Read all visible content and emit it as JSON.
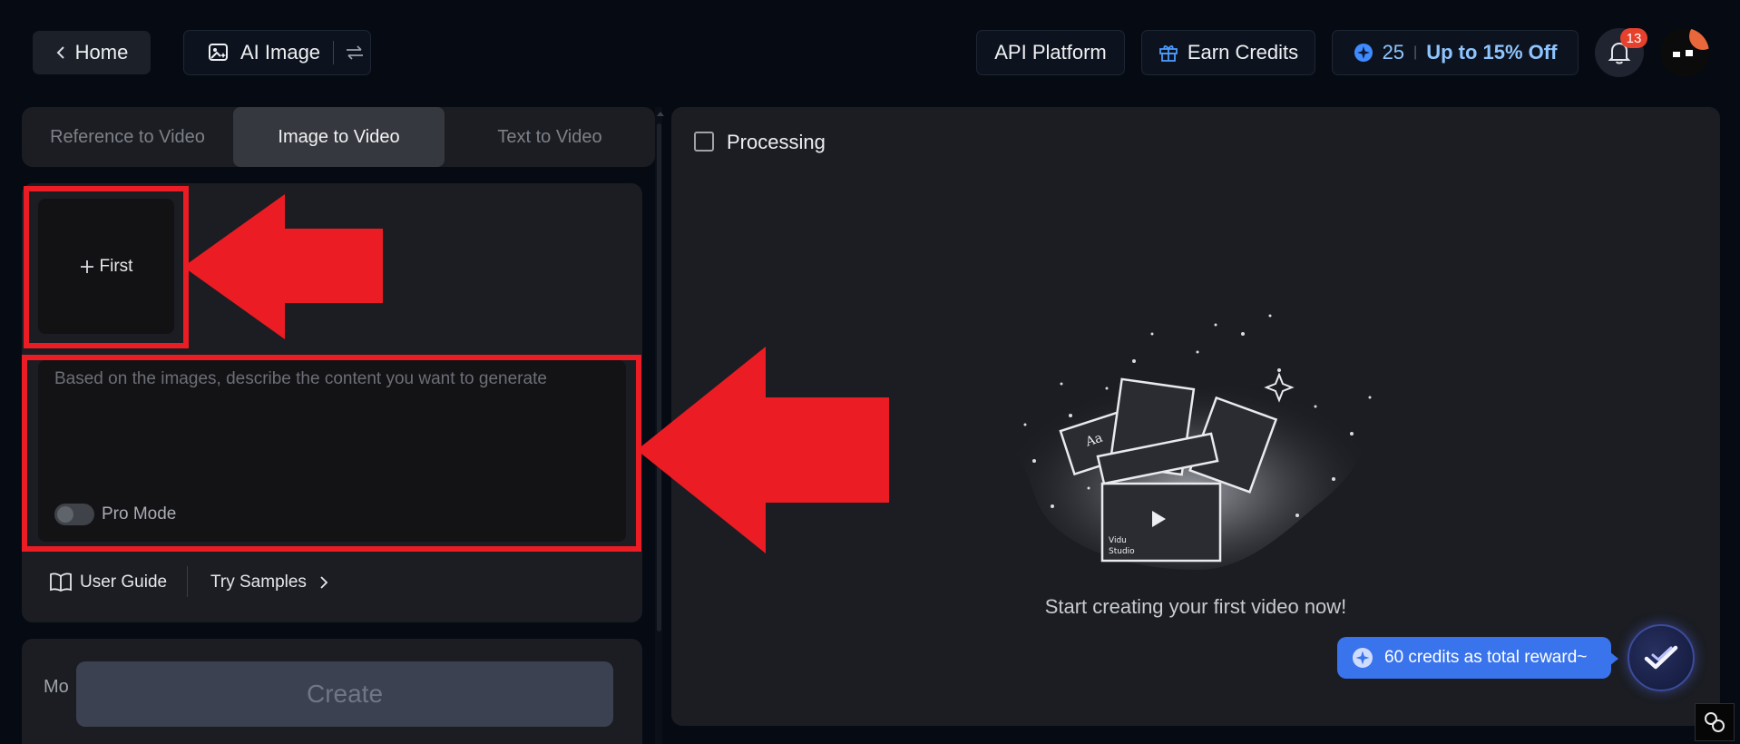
{
  "header": {
    "home_label": "Home",
    "ai_image_label": "AI Image",
    "api_platform_label": "API Platform",
    "earn_credits_label": "Earn Credits",
    "credits_count": "25",
    "credits_separator": "|",
    "discount_label": "Up to 15% Off",
    "notification_count": "13"
  },
  "tabs": [
    {
      "label": "Reference to Video",
      "active": false
    },
    {
      "label": "Image to Video",
      "active": true
    },
    {
      "label": "Text to Video",
      "active": false
    }
  ],
  "upload": {
    "label": "First"
  },
  "prompt": {
    "placeholder": "Based on the images, describe the content you want to generate",
    "pro_mode_label": "Pro Mode",
    "pro_mode_enabled": false
  },
  "footer_links": {
    "user_guide": "User Guide",
    "try_samples": "Try Samples"
  },
  "model_section": {
    "label_partial": "Mo"
  },
  "create_button": {
    "label": "Create"
  },
  "main": {
    "processing_label": "Processing",
    "processing_checked": false,
    "empty_message": "Start creating your first video now!",
    "illustration_text": {
      "aa": "Aa",
      "brand_line1": "Vidu",
      "brand_line2": "Studio"
    }
  },
  "reward": {
    "label": "60 credits as total reward~"
  },
  "colors": {
    "background": "#050a13",
    "panel": "#1b1d22",
    "accent_blue": "#4a86ff",
    "discount_text": "#8ec5ff",
    "highlight_red": "#ec1c24",
    "badge_red": "#e5412c"
  }
}
